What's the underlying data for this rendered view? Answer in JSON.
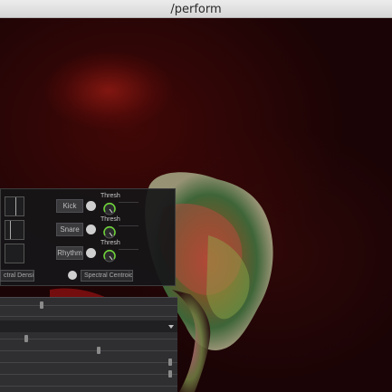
{
  "window": {
    "title": "/perform"
  },
  "panel": {
    "triggers": [
      {
        "button_label": "Kick",
        "knob_label": "Thresh"
      },
      {
        "button_label": "Snare",
        "knob_label": "Thresh"
      },
      {
        "button_label": "Rhythm",
        "knob_label": "Thresh"
      }
    ],
    "left_field_label": "ctral Density",
    "right_field_label": "Spectral Centroid"
  },
  "colors": {
    "knob_arc": "#6fd23a",
    "background": "#1b0405"
  },
  "icons": [
    "toggle-dot-icon",
    "knob-icon",
    "dropdown-arrow-icon"
  ]
}
